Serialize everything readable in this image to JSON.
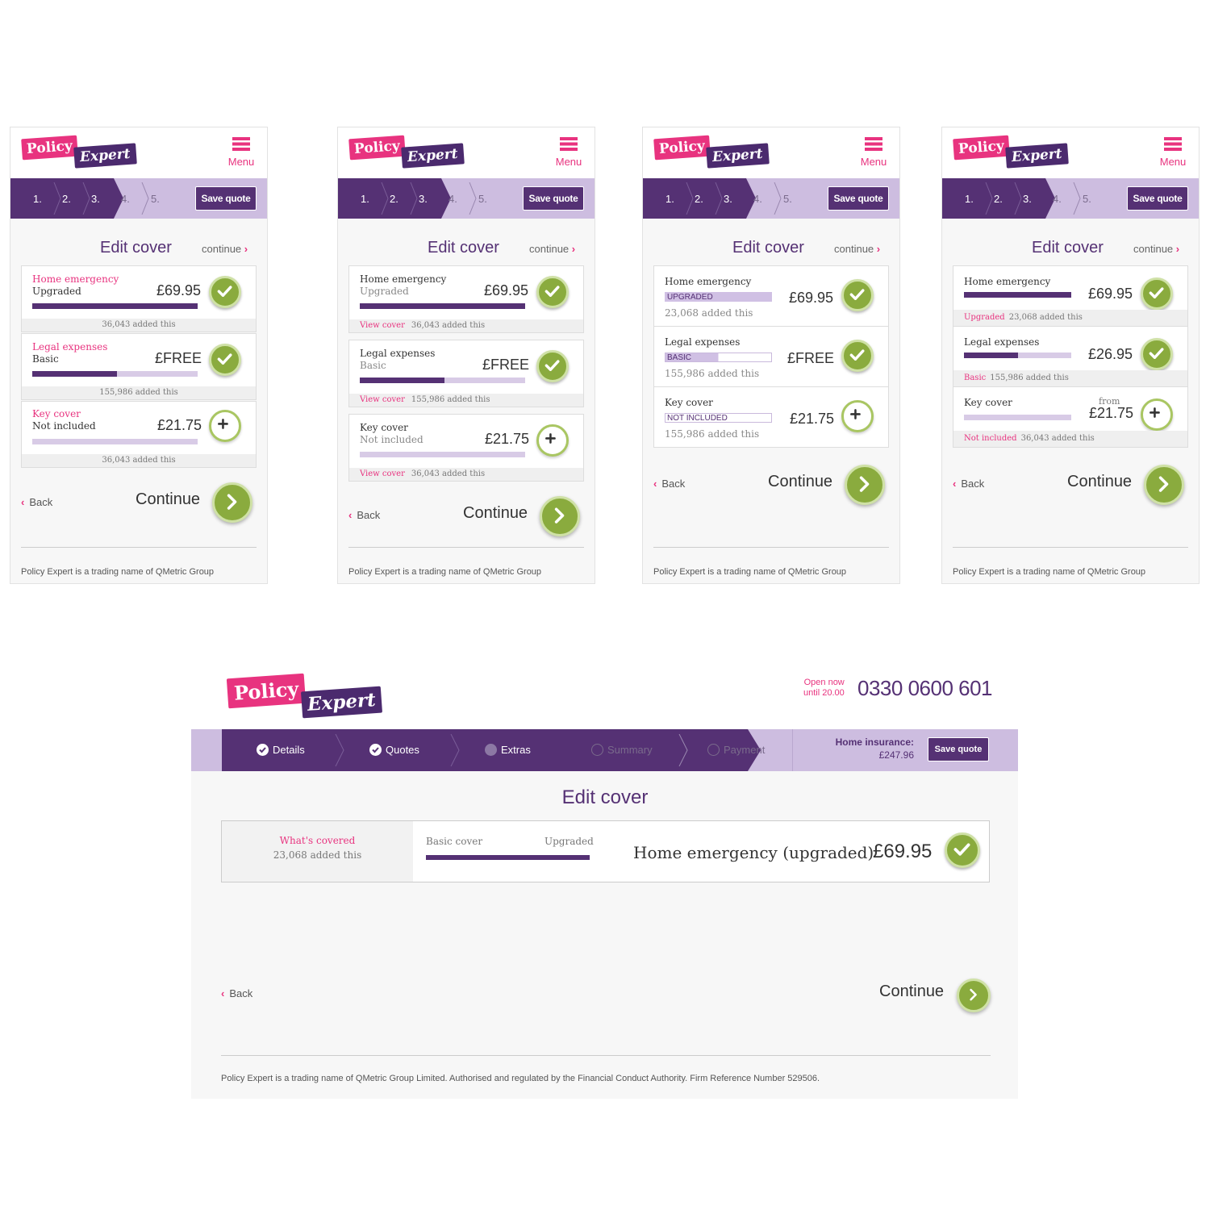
{
  "brand": {
    "logo_part1": "Policy",
    "logo_part2": "Expert",
    "pink": "#e8337f",
    "purple": "#553174",
    "light_purple": "#cdbde0",
    "green": "#8aab3e"
  },
  "common": {
    "menu_label": "Menu",
    "steps": [
      "1.",
      "2.",
      "3.",
      "4.",
      "5."
    ],
    "save_quote": "Save quote",
    "page_title": "Edit cover",
    "continue_link": "continue",
    "back": "Back",
    "continue": "Continue",
    "footer_short": "Policy Expert is a trading name of QMetric Group"
  },
  "screen1": {
    "cards": [
      {
        "name": "Home emergency",
        "status": "Upgraded",
        "price": "£69.95",
        "fill": 1.0,
        "added": "36,043 added this",
        "selected": true
      },
      {
        "name": "Legal expenses",
        "status": "Basic",
        "price": "£FREE",
        "fill": 0.5,
        "added": "155,986 added this",
        "selected": true
      },
      {
        "name": "Key cover",
        "status": "Not included",
        "price": "£21.75",
        "fill": 0.0,
        "added": "36,043 added this",
        "selected": false
      }
    ]
  },
  "screen2": {
    "view_cover": "View cover",
    "cards": [
      {
        "name": "Home emergency",
        "status": "Upgraded",
        "price": "£69.95",
        "fill": 1.0,
        "added": "36,043 added this",
        "selected": true
      },
      {
        "name": "Legal expenses",
        "status": "Basic",
        "price": "£FREE",
        "fill": 0.5,
        "added": "155,986 added this",
        "selected": true
      },
      {
        "name": "Key cover",
        "status": "Not included",
        "price": "£21.75",
        "fill": 0.0,
        "added": "36,043 added this",
        "selected": false
      }
    ]
  },
  "screen3": {
    "cards": [
      {
        "name": "Home emergency",
        "tag": "UPGRADED",
        "price": "£69.95",
        "fill": 1.0,
        "added": "23,068 added this",
        "selected": true
      },
      {
        "name": "Legal expenses",
        "tag": "BASIC",
        "price": "£FREE",
        "fill": 0.5,
        "added": "155,986 added this",
        "selected": true
      },
      {
        "name": "Key cover",
        "tag": "NOT INCLUDED",
        "price": "£21.75",
        "fill": 0.0,
        "added": "155,986 added this",
        "selected": false
      }
    ]
  },
  "screen4": {
    "from_label": "from",
    "cards": [
      {
        "name": "Home emergency",
        "status": "Upgraded",
        "price": "£69.95",
        "fill": 1.0,
        "added": "23,068 added this",
        "selected": true
      },
      {
        "name": "Legal expenses",
        "status": "Basic",
        "price": "£26.95",
        "fill": 0.5,
        "added": "155,986 added this",
        "selected": true
      },
      {
        "name": "Key cover",
        "status": "Not included",
        "price": "£21.75",
        "fill": 0.0,
        "added": "36,043 added this",
        "selected": false
      }
    ]
  },
  "desktop": {
    "open_line1": "Open now",
    "open_line2": "until 20.00",
    "phone": "0330 0600 601",
    "steps": [
      {
        "label": "Details",
        "state": "done"
      },
      {
        "label": "Quotes",
        "state": "done"
      },
      {
        "label": "Extras",
        "state": "current"
      },
      {
        "label": "Summary",
        "state": "todo"
      },
      {
        "label": "Payment",
        "state": "todo"
      }
    ],
    "home_insurance_label": "Home insurance:",
    "home_insurance_amount": "£247.96",
    "save_quote": "Save quote",
    "title": "Edit cover",
    "whats_covered": "What's covered",
    "added": "23,068 added this",
    "basic_cover": "Basic cover",
    "upgraded": "Upgraded",
    "product": "Home emergency (upgraded)",
    "price": "£69.95",
    "back": "Back",
    "continue": "Continue",
    "footer": "Policy Expert is a trading name of QMetric Group Limited. Authorised and regulated by the Financial Conduct Authority. Firm Reference Number 529506."
  }
}
